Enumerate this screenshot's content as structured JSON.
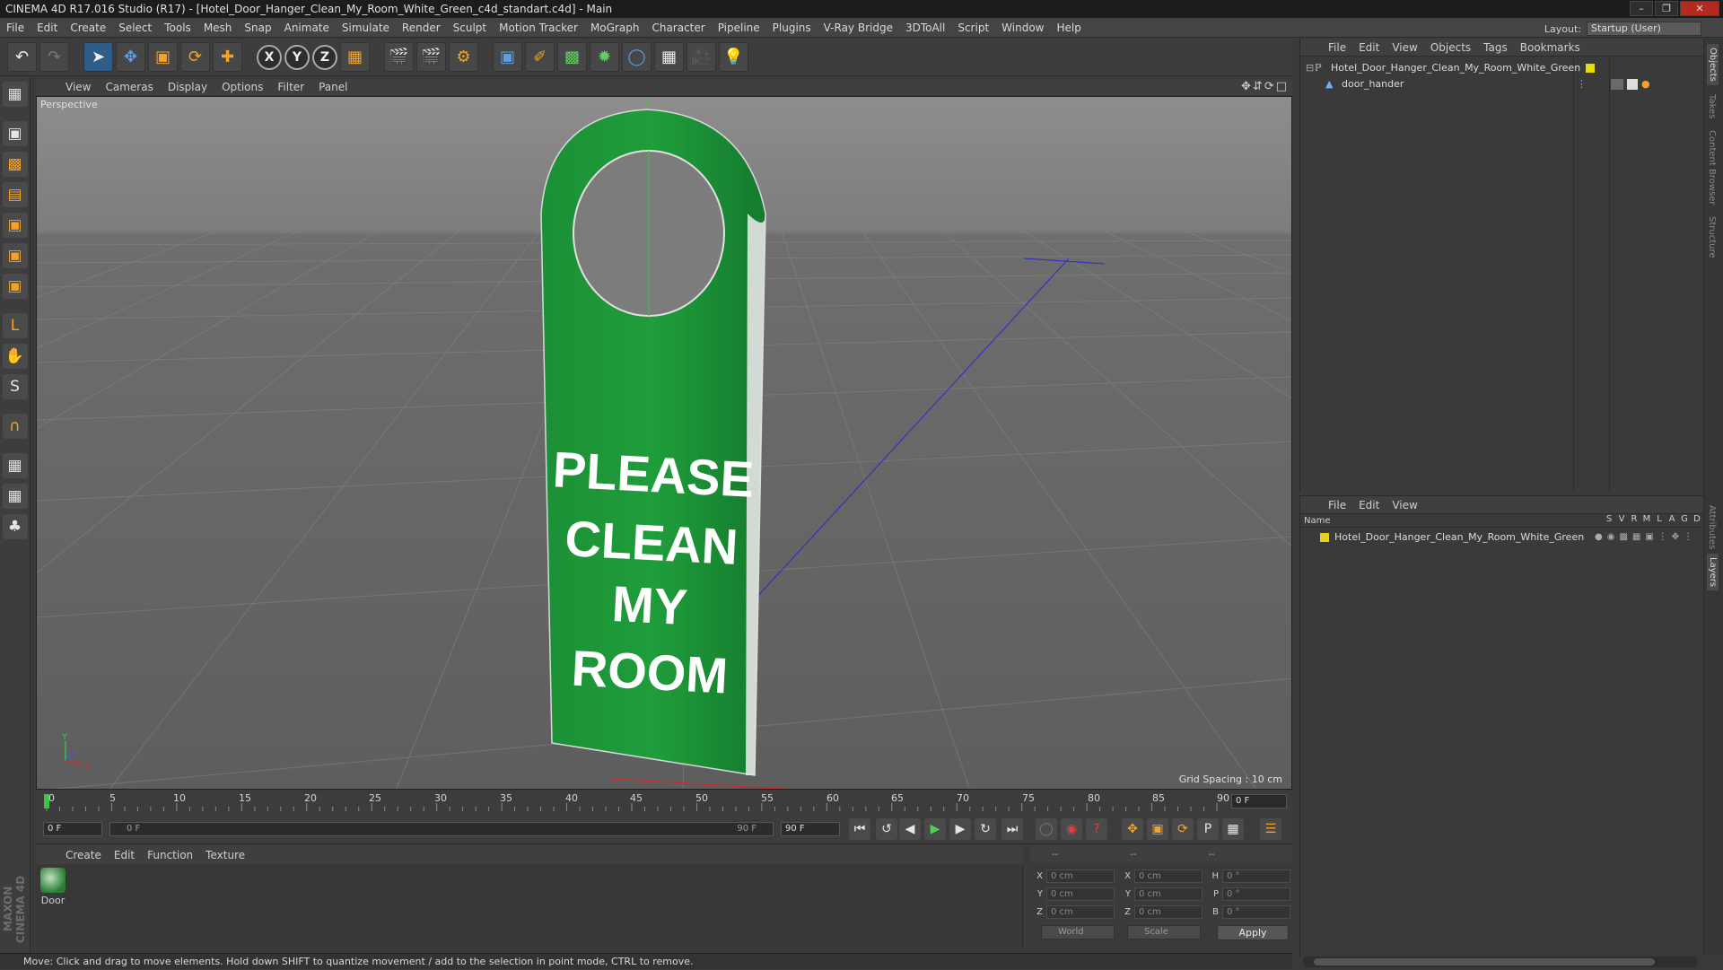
{
  "window": {
    "title": "CINEMA 4D R17.016 Studio (R17) - [Hotel_Door_Hanger_Clean_My_Room_White_Green_c4d_standart.c4d] - Main"
  },
  "menubar": [
    "File",
    "Edit",
    "Create",
    "Select",
    "Tools",
    "Mesh",
    "Snap",
    "Animate",
    "Simulate",
    "Render",
    "Sculpt",
    "Motion Tracker",
    "MoGraph",
    "Character",
    "Pipeline",
    "Plugins",
    "V-Ray Bridge",
    "3DToAll",
    "Script",
    "Window",
    "Help"
  ],
  "layout": {
    "label": "Layout:",
    "value": "Startup (User)"
  },
  "viewport": {
    "menu": [
      "View",
      "Cameras",
      "Display",
      "Options",
      "Filter",
      "Panel"
    ],
    "camera_label": "Perspective",
    "grid_spacing": "Grid Spacing : 10 cm",
    "hanger_text": [
      "PLEASE",
      "CLEAN",
      "MY",
      "ROOM"
    ],
    "hanger_color": "#1d9a3a",
    "axes": {
      "y": "Y",
      "x": "X"
    }
  },
  "timeline": {
    "ticks": [
      "0",
      "5",
      "10",
      "15",
      "20",
      "25",
      "30",
      "35",
      "40",
      "45",
      "50",
      "55",
      "60",
      "65",
      "70",
      "75",
      "80",
      "85",
      "90"
    ],
    "current_frame": "0 F"
  },
  "transport": {
    "start_frame": "0 F",
    "range_start": "0 F",
    "range_end": "90 F",
    "end_frame": "90 F"
  },
  "material_manager": {
    "menu": [
      "Create",
      "Edit",
      "Function",
      "Texture"
    ],
    "materials": [
      {
        "name": "Door"
      }
    ]
  },
  "coordinates": {
    "header": [
      "--",
      "--",
      "--"
    ],
    "rows": [
      {
        "a_label": "X",
        "a_val": "0 cm",
        "b_label": "X",
        "b_val": "0 cm",
        "c_label": "H",
        "c_val": "0 °"
      },
      {
        "a_label": "Y",
        "a_val": "0 cm",
        "b_label": "Y",
        "b_val": "0 cm",
        "c_label": "P",
        "c_val": "0 °"
      },
      {
        "a_label": "Z",
        "a_val": "0 cm",
        "b_label": "Z",
        "b_val": "0 cm",
        "c_label": "B",
        "c_val": "0 °"
      }
    ],
    "space": "World",
    "mode": "Scale",
    "apply_label": "Apply"
  },
  "object_manager": {
    "menu": [
      "File",
      "Edit",
      "View",
      "Objects",
      "Tags",
      "Bookmarks"
    ],
    "objects": [
      {
        "name": "Hotel_Door_Hanger_Clean_My_Room_White_Green"
      },
      {
        "name": "door_hander"
      }
    ]
  },
  "layer_manager": {
    "menu": [
      "File",
      "Edit",
      "View"
    ],
    "name_header": "Name",
    "columns": [
      "S",
      "V",
      "R",
      "M",
      "L",
      "A",
      "G",
      "D"
    ],
    "layers": [
      {
        "name": "Hotel_Door_Hanger_Clean_My_Room_White_Green",
        "color": "#e6d21e"
      }
    ]
  },
  "side_tabs": [
    "Objects",
    "Takes",
    "Content Browser",
    "Structure",
    "Attributes",
    "Layers"
  ],
  "status_bar": "Move: Click and drag to move elements. Hold down SHIFT to quantize movement / add to the selection in point mode, CTRL to remove.",
  "branding": "MAXON CINEMA 4D"
}
